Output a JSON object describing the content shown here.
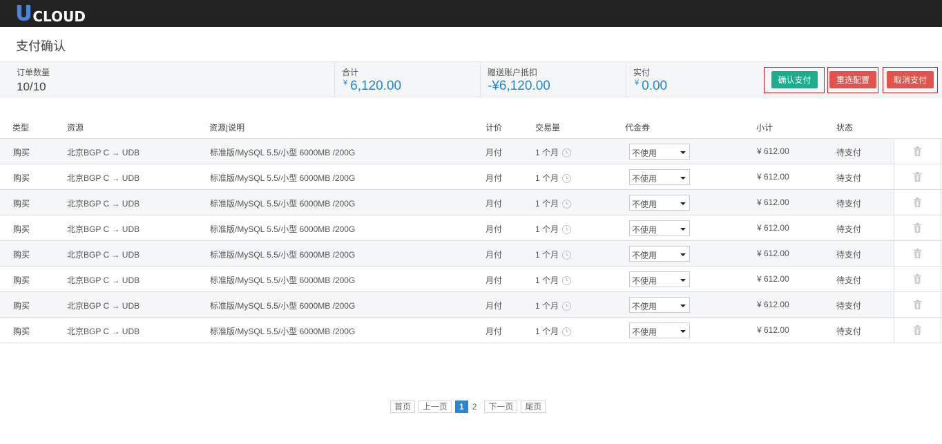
{
  "header": {
    "logo_u": "U",
    "logo_rest": "CLOUD"
  },
  "page": {
    "title": "支付确认"
  },
  "summary": {
    "order_count_label": "订单数量",
    "order_count_value": "10/10",
    "total_label": "合计",
    "total_currency": "¥",
    "total_value": "6,120.00",
    "gift_label": "赠送账户抵扣",
    "gift_value": "-¥6,120.00",
    "paid_label": "实付",
    "paid_currency": "¥",
    "paid_value": "0.00"
  },
  "actions": {
    "confirm_label": "确认支付",
    "reselect_label": "重选配置",
    "cancel_label": "取消支付"
  },
  "colors": {
    "confirm": "#1aae8c",
    "danger": "#e2544b",
    "amount": "#1e8ad0",
    "page_active": "#2a86d1"
  },
  "table": {
    "columns": [
      "类型",
      "资源",
      "资源|说明",
      "计价",
      "交易量",
      "代金券",
      "小计",
      "状态"
    ],
    "rows": [
      {
        "type": "购买",
        "resource": "北京BGP C → UDB",
        "desc": "标准版/MySQL 5.5/小型 6000MB /200G",
        "pricing": "月付",
        "qty": "1 个月",
        "voucher": "不使用",
        "subtotal": "¥ 612.00",
        "status": "待支付"
      },
      {
        "type": "购买",
        "resource": "北京BGP C → UDB",
        "desc": "标准版/MySQL 5.5/小型 6000MB /200G",
        "pricing": "月付",
        "qty": "1 个月",
        "voucher": "不使用",
        "subtotal": "¥ 612.00",
        "status": "待支付"
      },
      {
        "type": "购买",
        "resource": "北京BGP C → UDB",
        "desc": "标准版/MySQL 5.5/小型 6000MB /200G",
        "pricing": "月付",
        "qty": "1 个月",
        "voucher": "不使用",
        "subtotal": "¥ 612.00",
        "status": "待支付"
      },
      {
        "type": "购买",
        "resource": "北京BGP C → UDB",
        "desc": "标准版/MySQL 5.5/小型 6000MB /200G",
        "pricing": "月付",
        "qty": "1 个月",
        "voucher": "不使用",
        "subtotal": "¥ 612.00",
        "status": "待支付"
      },
      {
        "type": "购买",
        "resource": "北京BGP C → UDB",
        "desc": "标准版/MySQL 5.5/小型 6000MB /200G",
        "pricing": "月付",
        "qty": "1 个月",
        "voucher": "不使用",
        "subtotal": "¥ 612.00",
        "status": "待支付"
      },
      {
        "type": "购买",
        "resource": "北京BGP C → UDB",
        "desc": "标准版/MySQL 5.5/小型 6000MB /200G",
        "pricing": "月付",
        "qty": "1 个月",
        "voucher": "不使用",
        "subtotal": "¥ 612.00",
        "status": "待支付"
      },
      {
        "type": "购买",
        "resource": "北京BGP C → UDB",
        "desc": "标准版/MySQL 5.5/小型 6000MB /200G",
        "pricing": "月付",
        "qty": "1 个月",
        "voucher": "不使用",
        "subtotal": "¥ 612.00",
        "status": "待支付"
      },
      {
        "type": "购买",
        "resource": "北京BGP C → UDB",
        "desc": "标准版/MySQL 5.5/小型 6000MB /200G",
        "pricing": "月付",
        "qty": "1 个月",
        "voucher": "不使用",
        "subtotal": "¥ 612.00",
        "status": "待支付"
      }
    ]
  },
  "pagination": {
    "first": "首页",
    "prev": "上一页",
    "pages": [
      "1",
      "2"
    ],
    "current": "1",
    "next": "下一页",
    "last": "尾页"
  }
}
